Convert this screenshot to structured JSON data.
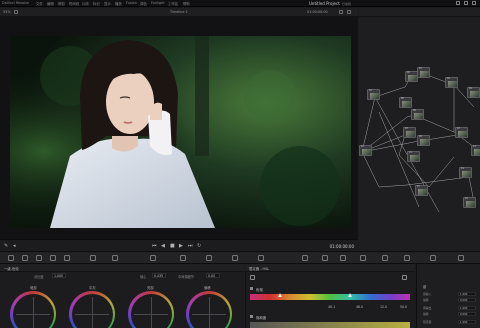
{
  "menu": {
    "items": [
      "DaVinci Resolve",
      "文件",
      "编辑",
      "修剪",
      "时间线",
      "片段",
      "标记",
      "显示",
      "播放",
      "Fusion",
      "调色",
      "Fairlight",
      "工作区",
      "帮助"
    ]
  },
  "project": {
    "title": "Untitled Project",
    "status": "已编辑"
  },
  "viewer": {
    "zoom": "53%",
    "timeline_name": "Timeline 1",
    "timecode_top": "01:00:00:00",
    "timecode": "01:00:00:00"
  },
  "node_editor": {
    "nodes": [
      "01",
      "02",
      "03",
      "04",
      "05",
      "06",
      "07",
      "08",
      "09",
      "10",
      "11",
      "12",
      "13",
      "14",
      "15",
      "16"
    ]
  },
  "color_panel": {
    "title": "一级-色轮",
    "params": [
      {
        "label": "对比度",
        "value": "1.000"
      },
      {
        "label": "轴心",
        "value": "0.435"
      },
      {
        "label": "中间调细节",
        "value": "0.00"
      }
    ],
    "wheels": [
      "暗部",
      "中灰",
      "亮部",
      "偏移"
    ]
  },
  "hsl_panel": {
    "title": "限定器 - HSL",
    "hue_label": "色相",
    "range_values": [
      "40.1",
      "46.0",
      "12.0",
      "50.0"
    ],
    "sat_label": "饱和度"
  },
  "inspector": {
    "title": "键",
    "rows": [
      {
        "label": "键输入",
        "value": "1.000"
      },
      {
        "label": "偏移",
        "value": "0.000"
      },
      {
        "label": "键输出",
        "value": "1.000"
      },
      {
        "label": "偏移",
        "value": "0.000"
      },
      {
        "label": "限定器",
        "value": "1.000"
      }
    ]
  }
}
